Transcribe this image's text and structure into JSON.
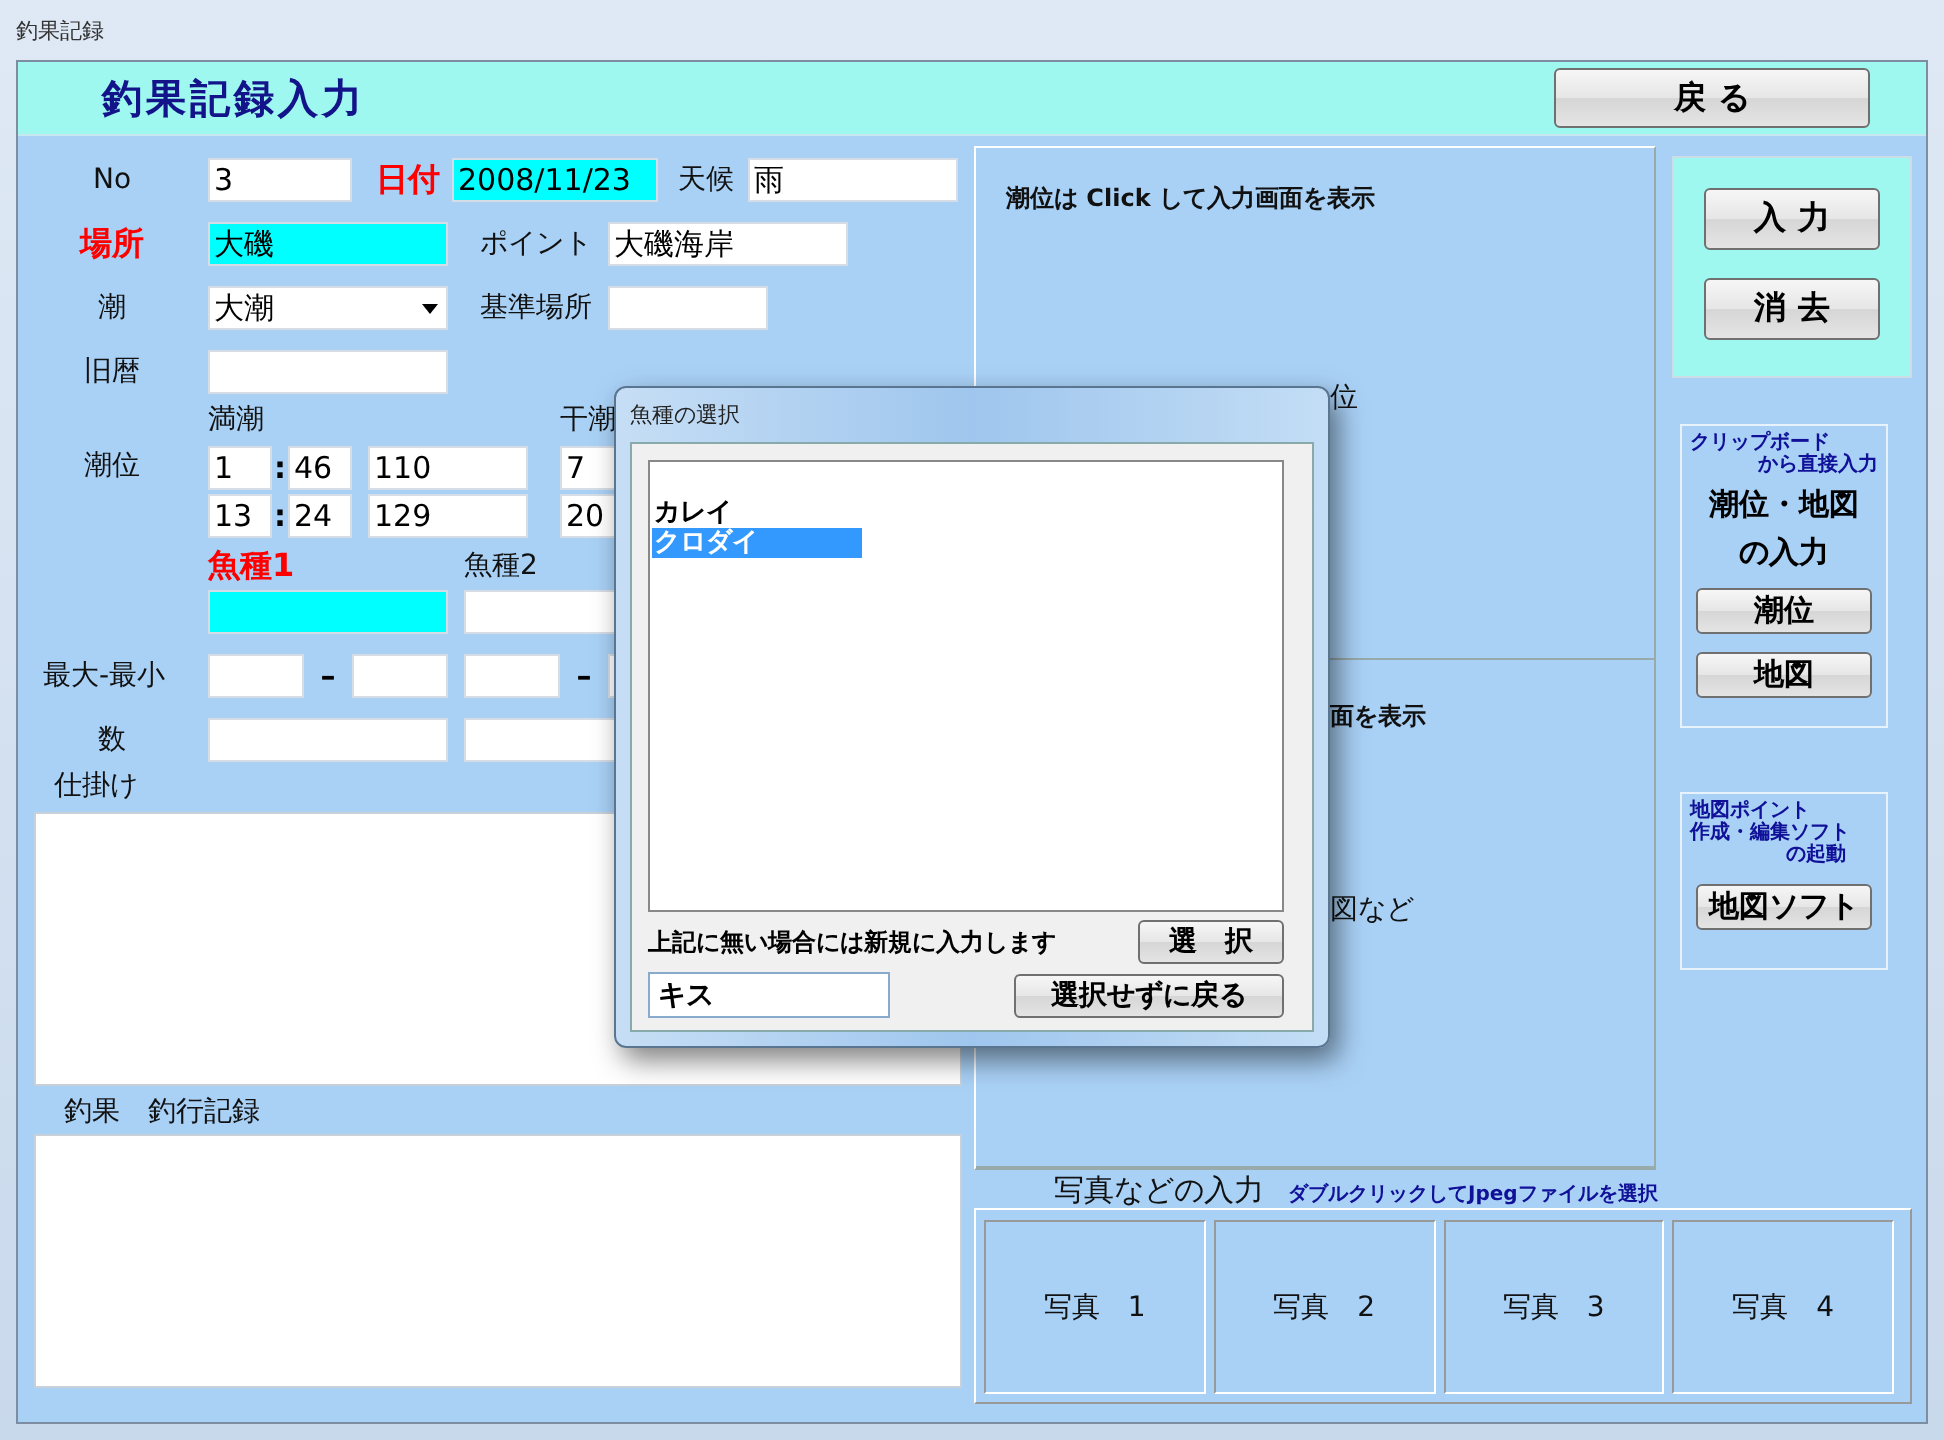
{
  "window": {
    "title": "釣果記録"
  },
  "header": {
    "title": "釣果記録入力",
    "back_button": "戻 る"
  },
  "form": {
    "no": {
      "label": "No",
      "value": "3"
    },
    "date": {
      "label": "日付",
      "value": "2008/11/23",
      "required": true,
      "highlighted": true
    },
    "weather": {
      "label": "天候",
      "value": "雨",
      "highlighted": false
    },
    "place": {
      "label": "場所",
      "value": "大磯",
      "required": true,
      "highlighted": true
    },
    "point": {
      "label": "ポイント",
      "value": "大磯海岸"
    },
    "tide": {
      "label": "潮",
      "value": "大潮"
    },
    "reference_place": {
      "label": "基準場所"
    },
    "lunar": {
      "label": "旧暦"
    },
    "tide_level": {
      "label": "潮位",
      "high_label": "満潮",
      "low_label": "干潮",
      "separator": ":",
      "rows": [
        {
          "high_hour": "1",
          "high_minute": "46",
          "high_level": "110",
          "low_hour": "7"
        },
        {
          "high_hour": "13",
          "high_minute": "24",
          "high_level": "129",
          "low_hour": "20"
        }
      ]
    },
    "fish": [
      {
        "label": "魚種1",
        "required": true,
        "highlighted": true
      },
      {
        "label": "魚種2",
        "required": false,
        "highlighted": false
      }
    ],
    "size": {
      "label": "最大-最小",
      "separator": "–"
    },
    "count": {
      "label": "数"
    },
    "tackle": {
      "label": "仕掛け"
    },
    "record": {
      "label": "釣果　釣行記録"
    }
  },
  "tide_panel": {
    "hint": "潮位は Click して入力画面を表示",
    "visible_text": "位"
  },
  "map_panel": {
    "visible_texts": [
      "面を表示",
      "図など"
    ]
  },
  "actions": [
    "入 力",
    "消 去"
  ],
  "clipboard": {
    "caption_lines": [
      "クリップボード",
      "から直接入力"
    ],
    "title_lines": [
      "潮位・地図",
      "の入力"
    ],
    "buttons": [
      "潮位",
      "地図"
    ]
  },
  "map_soft": {
    "caption_lines": [
      "地図ポイント",
      "作成・編集ソフト",
      "の起動"
    ],
    "button": "地図ソフト"
  },
  "photos": {
    "title": "写真などの入力",
    "hint": "ダブルクリックしてJpegファイルを選択",
    "slots": [
      "写真　1",
      "写真　2",
      "写真　3",
      "写真　4"
    ]
  },
  "dialog": {
    "title": "魚種の選択",
    "items": [
      {
        "label": "カレイ",
        "selected": false
      },
      {
        "label": "クロダイ",
        "selected": true
      }
    ],
    "note": "上記に無い場合には新規に入力します",
    "select_button": "選　択",
    "new_entry": "キス",
    "cancel_button": "選択せずに戻る"
  }
}
